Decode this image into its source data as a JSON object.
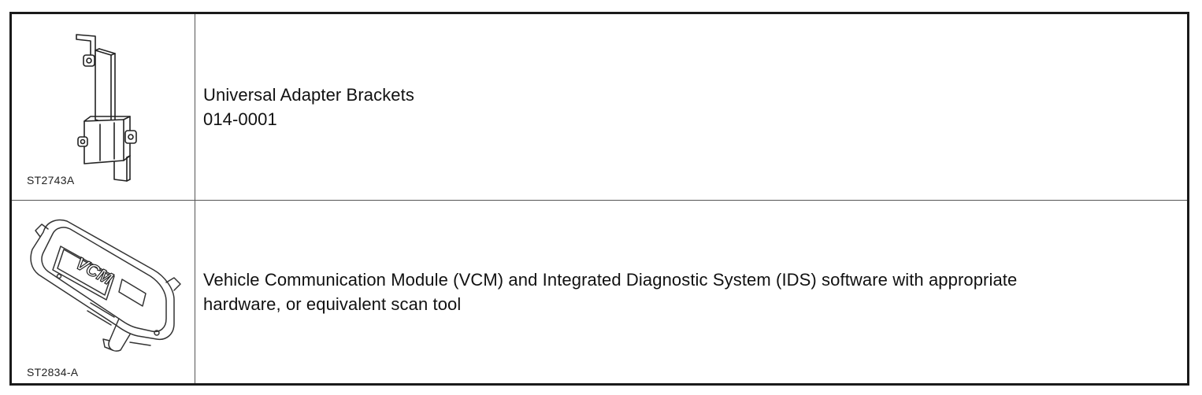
{
  "tools": [
    {
      "figure_id": "ST2743A",
      "illustration_icon": "adapter-bracket-illustration",
      "name": "Universal Adapter Brackets",
      "part_number": "014-0001"
    },
    {
      "figure_id": "ST2834-A",
      "illustration_icon": "vcm-module-illustration",
      "name": "Vehicle Communication Module (VCM) and Integrated Diagnostic System (IDS) software with appropriate",
      "name_cont": "hardware, or equivalent scan tool",
      "module_text": "VCM"
    }
  ]
}
